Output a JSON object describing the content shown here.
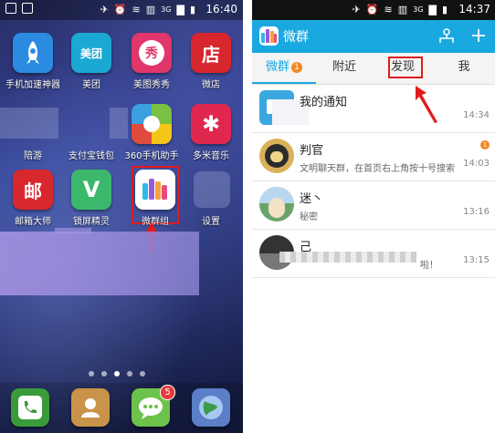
{
  "left_screen": {
    "status_bar": {
      "time": "16:40",
      "network": "3G"
    },
    "apps_row1": [
      {
        "label": "手机加速神器",
        "color": "#2a8be0",
        "glyph": "🚀"
      },
      {
        "label": "美团",
        "color": "#1ba9d3",
        "glyph": "美团"
      },
      {
        "label": "美图秀秀",
        "color": "#e0366a",
        "glyph": "秀"
      },
      {
        "label": "微店",
        "color": "#d8262e",
        "glyph": "店"
      }
    ],
    "apps_row2": [
      {
        "label": "陪游"
      },
      {
        "label": "支付宝钱包"
      },
      {
        "label": "360手机助手",
        "color": "#7ac143",
        "glyph": "◐"
      },
      {
        "label": "多米音乐",
        "color": "#e0284f",
        "glyph": "✱"
      }
    ],
    "apps_row3": [
      {
        "label": "邮箱大师",
        "color": "#d9272e",
        "glyph": "邮"
      },
      {
        "label": "锁屏精灵",
        "color": "#3bb86b",
        "glyph": "V"
      },
      {
        "label": "微群组",
        "color": "#ffffff",
        "glyph": ""
      },
      {
        "label": "设置"
      }
    ],
    "dock": [
      {
        "name": "phone",
        "color": "#3a9b3a"
      },
      {
        "name": "contacts",
        "color": "#c9944a"
      },
      {
        "name": "messages",
        "color": "#6cc24a",
        "badge": "5"
      },
      {
        "name": "browser",
        "color": "#5a7fc8"
      }
    ]
  },
  "right_screen": {
    "status_bar": {
      "time": "14:37",
      "network": "3G"
    },
    "app_title": "微群",
    "toolbar_icons": [
      "contacts-icon",
      "add-icon"
    ],
    "tabs": [
      {
        "label": "微群",
        "badge": "1"
      },
      {
        "label": "附近"
      },
      {
        "label": "发现"
      },
      {
        "label": "我"
      }
    ],
    "conversations": [
      {
        "name": "我的通知",
        "preview": "",
        "time": "14:34"
      },
      {
        "name": "判官",
        "preview": "文明聊天群，在首页右上角按十号搜索...",
        "time": "14:03",
        "unread": "1"
      },
      {
        "name": "迷丶",
        "preview": "秘密",
        "time": "13:16"
      },
      {
        "name": "己",
        "preview": "啦！",
        "time": "13:15"
      }
    ]
  }
}
